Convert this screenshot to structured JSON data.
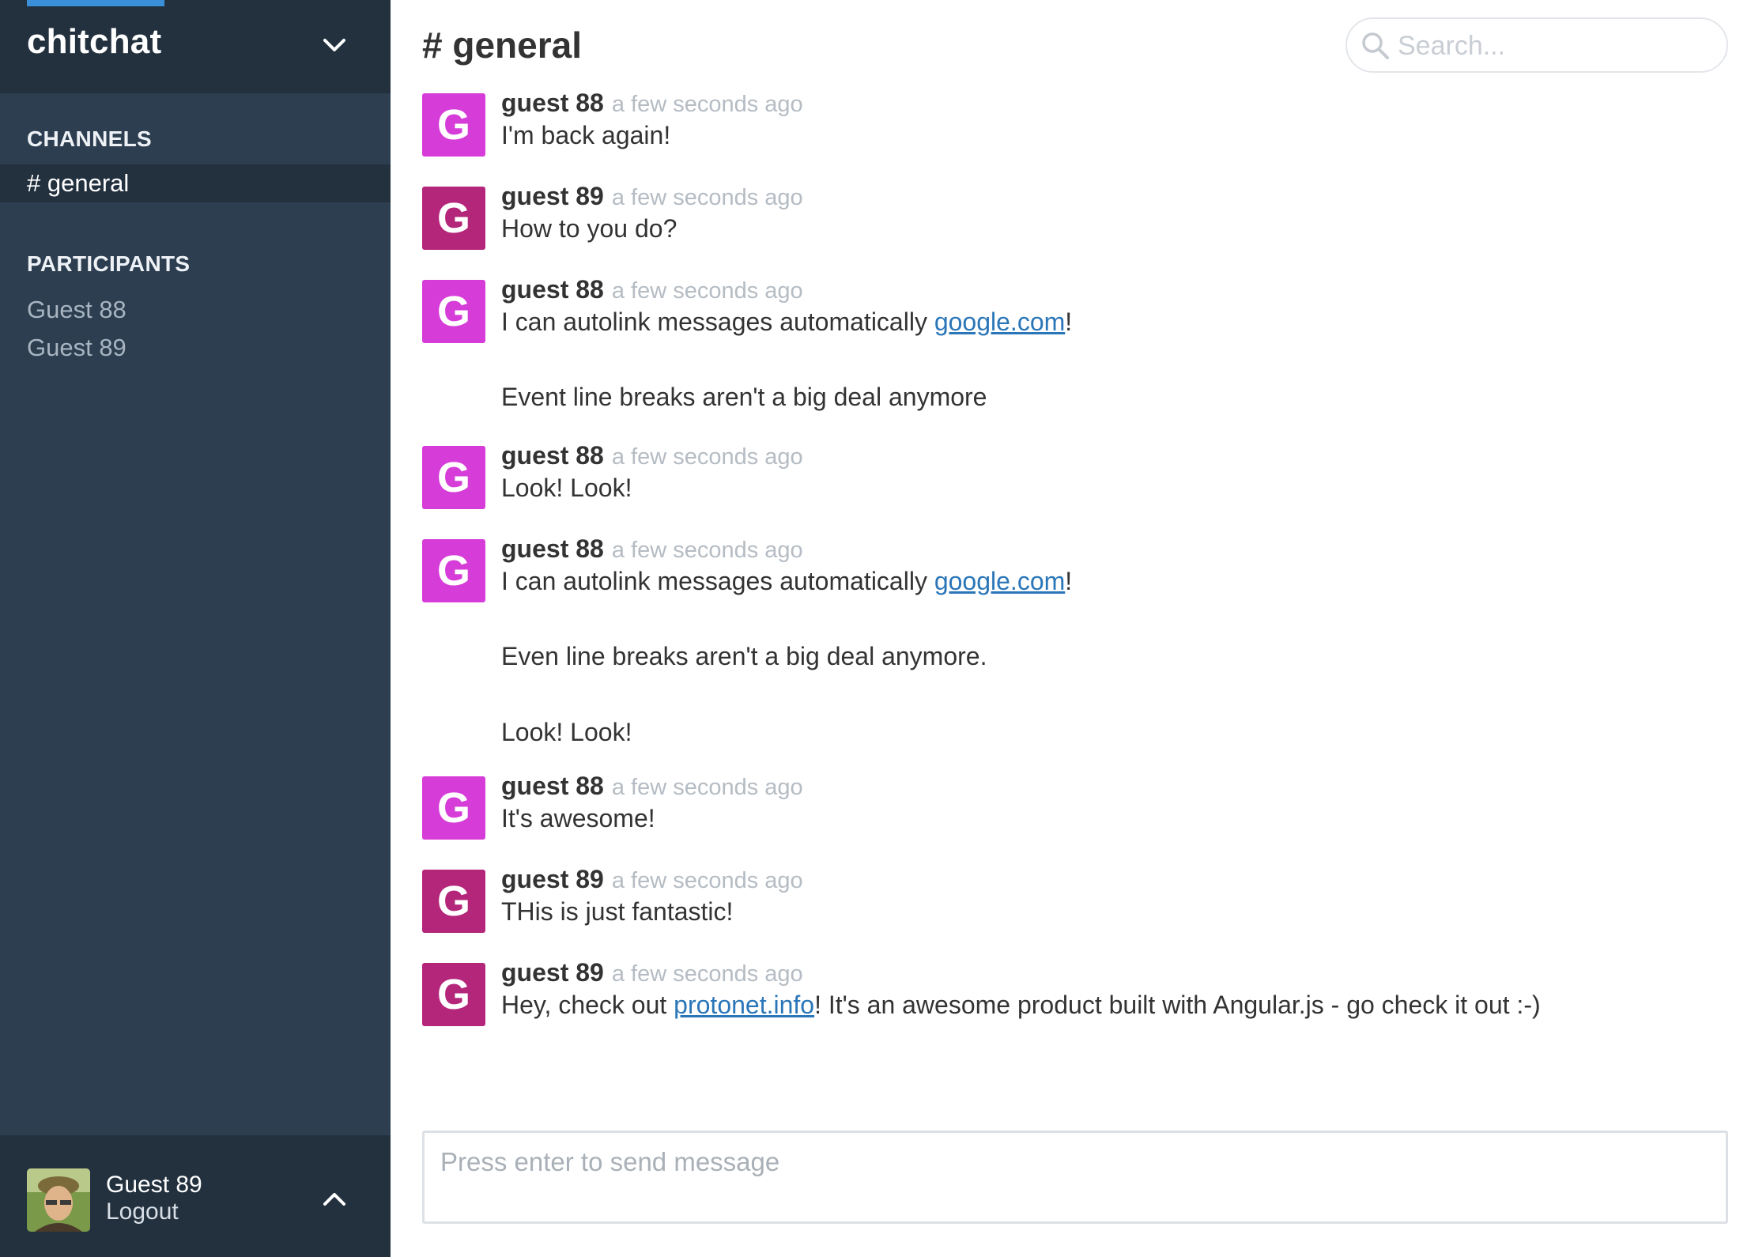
{
  "app": {
    "name": "chitchat",
    "accent_color": "#3a8fd9"
  },
  "sidebar": {
    "channels_heading": "CHANNELS",
    "channels": [
      {
        "label": "# general",
        "active": true
      }
    ],
    "participants_heading": "PARTICIPANTS",
    "participants": [
      "Guest 88",
      "Guest 89"
    ],
    "current_user": {
      "name": "Guest 89",
      "logout_label": "Logout"
    }
  },
  "header": {
    "channel_title": "# general",
    "search_placeholder": "Search..."
  },
  "colors": {
    "guest88_avatar": "#d63cd8",
    "guest89_avatar": "#b4267a",
    "link": "#2a76b8"
  },
  "messages": [
    {
      "author": "guest 88",
      "time": "a few seconds ago",
      "avatar_letter": "G",
      "avatar": "guest88",
      "lines": [
        {
          "text": "I'm back again!"
        }
      ]
    },
    {
      "author": "guest 89",
      "time": "a few seconds ago",
      "avatar_letter": "G",
      "avatar": "guest89",
      "lines": [
        {
          "text": "How to you do?"
        }
      ]
    },
    {
      "author": "guest 88",
      "time": "a few seconds ago",
      "avatar_letter": "G",
      "avatar": "guest88",
      "lines": [
        {
          "text": "I can autolink messages automatically ",
          "link": "google.com",
          "after": "!"
        },
        {
          "text": "Event line breaks aren't a big deal anymore"
        }
      ]
    },
    {
      "author": "guest 88",
      "time": "a few seconds ago",
      "avatar_letter": "G",
      "avatar": "guest88",
      "lines": [
        {
          "text": "Look! Look!"
        }
      ]
    },
    {
      "author": "guest 88",
      "time": "a few seconds ago",
      "avatar_letter": "G",
      "avatar": "guest88",
      "lines": [
        {
          "text": "I can autolink messages automatically ",
          "link": "google.com",
          "after": "!"
        },
        {
          "text": "Even line breaks aren't a big deal anymore."
        },
        {
          "text": "Look! Look!"
        }
      ]
    },
    {
      "author": "guest 88",
      "time": "a few seconds ago",
      "avatar_letter": "G",
      "avatar": "guest88",
      "lines": [
        {
          "text": "It's awesome!"
        }
      ]
    },
    {
      "author": "guest 89",
      "time": "a few seconds ago",
      "avatar_letter": "G",
      "avatar": "guest89",
      "lines": [
        {
          "text": "THis is just fantastic!"
        }
      ]
    },
    {
      "author": "guest 89",
      "time": "a few seconds ago",
      "avatar_letter": "G",
      "avatar": "guest89",
      "lines": [
        {
          "text": "Hey, check out ",
          "link": "protonet.info",
          "after": "! It's an awesome product built with Angular.js - go check it out :-)"
        }
      ]
    }
  ],
  "composer": {
    "placeholder": "Press enter to send message"
  }
}
